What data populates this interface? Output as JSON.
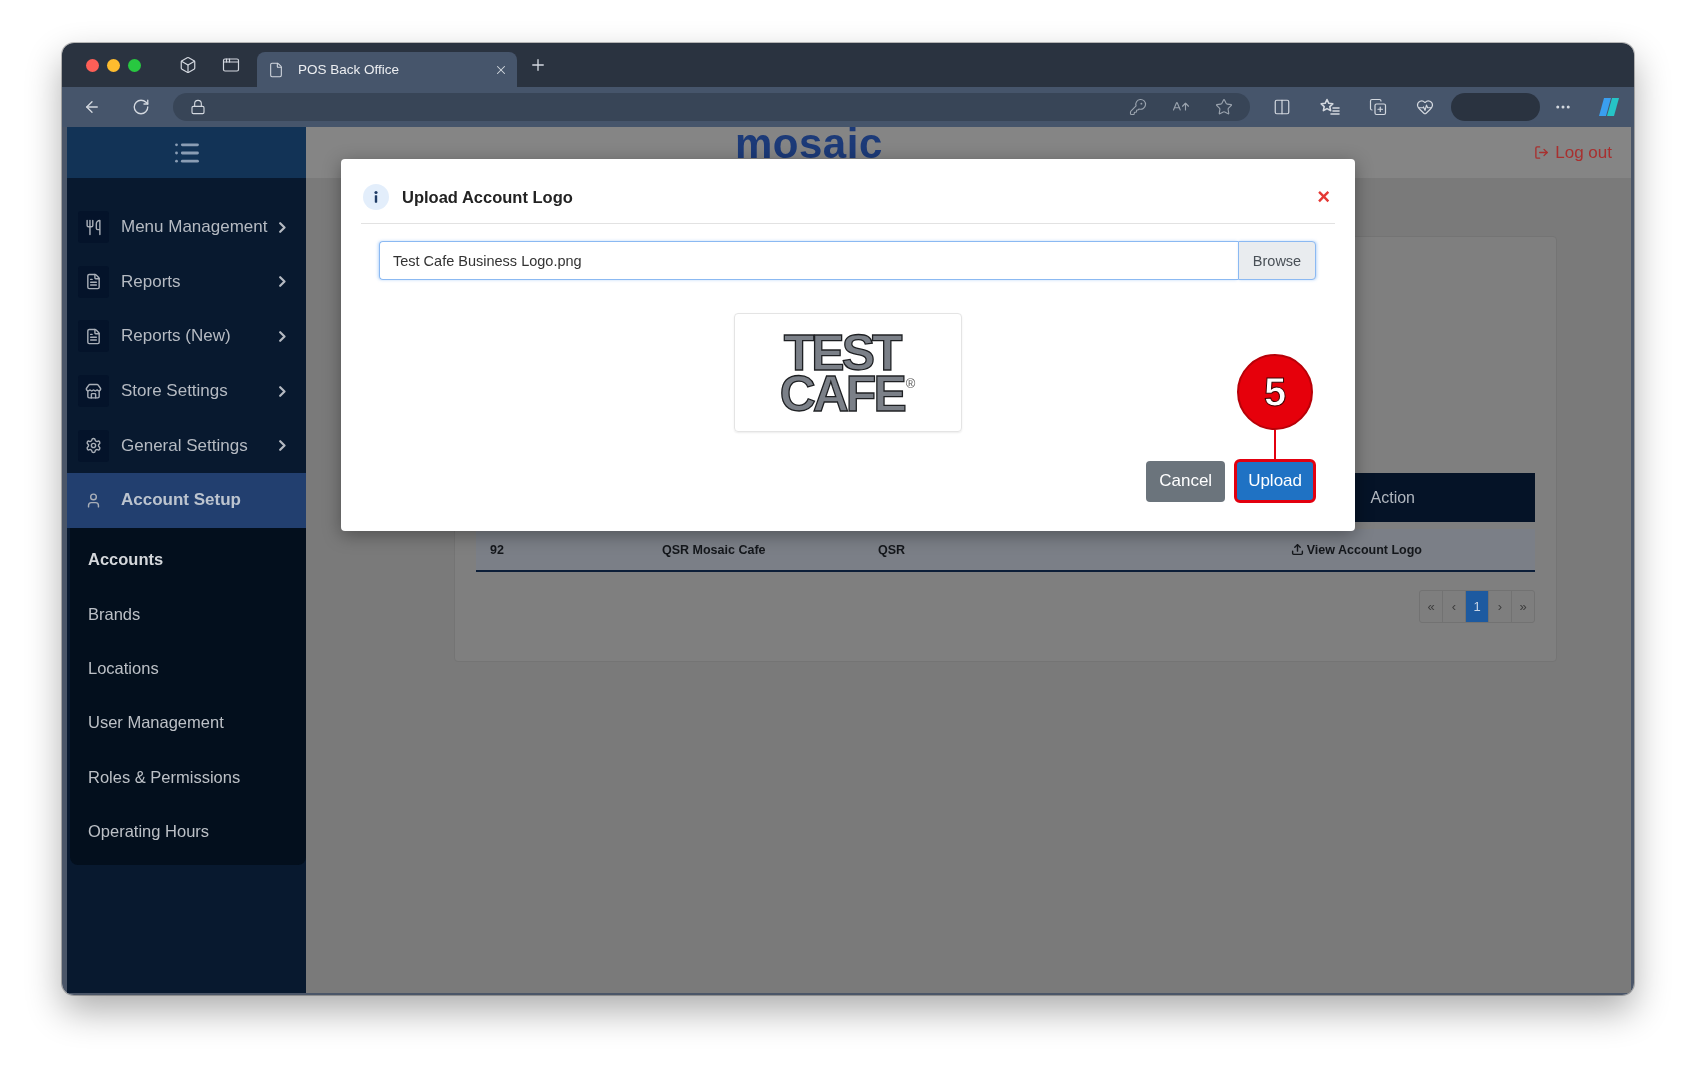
{
  "browser": {
    "tabs": [
      {
        "title": "POS Back Office",
        "selected": true
      }
    ]
  },
  "sidebar": {
    "items": [
      {
        "label": "Menu Management",
        "selected": false,
        "expanded": false
      },
      {
        "label": "Reports",
        "selected": false,
        "expanded": false
      },
      {
        "label": "Reports (New)",
        "selected": false,
        "expanded": false
      },
      {
        "label": "Store Settings",
        "selected": false,
        "expanded": false
      },
      {
        "label": "General Settings",
        "selected": false,
        "expanded": false
      },
      {
        "label": "Account Setup",
        "selected": true,
        "expanded": true,
        "children": [
          {
            "label": "Accounts",
            "selected": true
          },
          {
            "label": "Brands",
            "selected": false
          },
          {
            "label": "Locations",
            "selected": false
          },
          {
            "label": "User Management",
            "selected": false
          },
          {
            "label": "Roles & Permissions",
            "selected": false
          },
          {
            "label": "Operating Hours",
            "selected": false
          }
        ]
      }
    ]
  },
  "header": {
    "logo": "mosaic",
    "logout": "Log out"
  },
  "table": {
    "heading": "Action",
    "rows": [
      {
        "column_1": "92",
        "column_2": "QSR Mosaic Cafe",
        "column_3": "QSR",
        "action": "View Account Logo"
      }
    ]
  },
  "pagination": [
    {
      "label": "«",
      "selected": false
    },
    {
      "label": "‹",
      "selected": false
    },
    {
      "label": "1",
      "selected": true
    },
    {
      "label": "›",
      "selected": false
    },
    {
      "label": "»",
      "selected": false
    }
  ],
  "modal": {
    "title": "Upload Account Logo",
    "close": "×",
    "file_field": {
      "value": "Test Cafe Business Logo.png",
      "focused": true,
      "button": "Browse"
    },
    "preview": {
      "wordmark": "TEST CAFE",
      "mark": "®"
    },
    "buttons": [
      {
        "label": "Cancel",
        "kind": "cancel",
        "highlighted": false
      },
      {
        "label": "Upload",
        "kind": "submit",
        "highlighted": true
      }
    ]
  },
  "callout": {
    "number": "5"
  }
}
